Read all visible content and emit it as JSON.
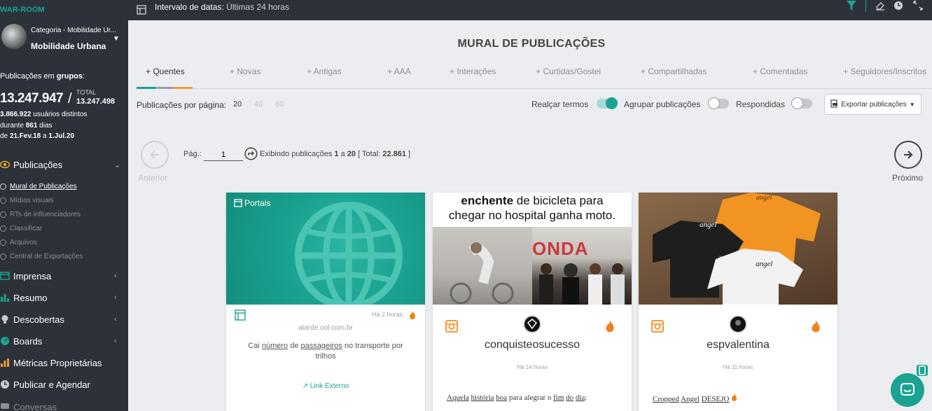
{
  "sidebar": {
    "brand": "WAR-ROOM",
    "category_sub": "Categoria - Mobilidade Ur...",
    "category_main": "Mobilidade Urbana",
    "pub_label_prefix": "Publicações em ",
    "pub_label_bold": "grupos",
    "pub_label_suffix": ":",
    "count": "13.247.947",
    "slash": "/",
    "total_label": "TOTAL",
    "total_value": "13.247.498",
    "users_value": "3.866.922",
    "users_label": " usuários distintos",
    "during_prefix": "durante ",
    "days_value": "861",
    "days_label": " dias",
    "from_prefix": "de ",
    "from_date": "21.Fev.18",
    "to_sep": " a ",
    "to_date": "1.Jul.20",
    "menu": [
      {
        "label": "Publicações"
      },
      {
        "label": "Imprensa"
      },
      {
        "label": "Resumo"
      },
      {
        "label": "Descobertas"
      },
      {
        "label": "Boards"
      },
      {
        "label": "Métricas Proprietárias"
      },
      {
        "label": "Publicar e Agendar"
      },
      {
        "label": "Conversas"
      }
    ],
    "submenu": [
      {
        "label": "Mural de Publicações"
      },
      {
        "label": "Mídias visuais"
      },
      {
        "label": "RTs de influenciadores"
      },
      {
        "label": "Classificar"
      },
      {
        "label": "Arquivos"
      },
      {
        "label": "Central de Exportações"
      }
    ]
  },
  "topbar": {
    "date_label": "Intervalo de datas:",
    "date_value": " Últimas 24 horas"
  },
  "main": {
    "title": "MURAL DE PUBLICAÇÕES",
    "tabs": [
      {
        "label": "+ Quentes"
      },
      {
        "label": "+ Novas"
      },
      {
        "label": "+ Antigas"
      },
      {
        "label": "+ AAA"
      },
      {
        "label": "+ Interações"
      },
      {
        "label": "+ Curtidas/Gostei"
      },
      {
        "label": "+ Compartilhadas"
      },
      {
        "label": "+ Comentadas"
      },
      {
        "label": "+ Seguidores/Inscritos"
      }
    ],
    "per_page_label": "Publicações por página:",
    "per_page_options": [
      "20",
      "40",
      "60"
    ],
    "highlight_label": "Realçar termos",
    "group_label": "Agrupar publicações",
    "answered_label": "Respondidas",
    "export_label": "Exportar publicações",
    "prev_label": "Anterior",
    "next_label": "Próximo",
    "page_label": "Pág.:",
    "page_value": "1",
    "showing_prefix": "Exibindo publicações ",
    "showing_from": "1",
    "showing_sep": " a ",
    "showing_to": "20",
    "showing_total_prefix": " [ Total: ",
    "showing_total": "22.861",
    "showing_total_suffix": " ]"
  },
  "cards": [
    {
      "source_label": "Portais",
      "time": "Há 2 horas",
      "domain": "atarde.uol.com.br",
      "text_parts": [
        "Cai ",
        "número",
        " de ",
        "passageiros",
        " no transporte por trilhos"
      ],
      "link_label": "Link Externo"
    },
    {
      "image_caption_bold": "enchente",
      "image_caption_rest": " de bicicleta para",
      "image_caption_line2": "chegar no hospital ganha moto.",
      "image_sign": "ONDA",
      "username": "conquisteosucesso",
      "time": "Há 14 horas",
      "text_words": [
        "Aquela",
        "história",
        "boa",
        "para alegrar o",
        "fim",
        "do",
        "dia",
        ":"
      ]
    },
    {
      "image_tag": "angel",
      "username": "espvalentina",
      "time": "Há 11 horas",
      "text_words": [
        "Cropped",
        "Angel",
        "DESEJO"
      ]
    }
  ],
  "colors": {
    "accent": "#1aa390",
    "sidebar_bg": "#2d3139",
    "instagram_orange": "#f29a38",
    "fire": "#f0821e"
  }
}
